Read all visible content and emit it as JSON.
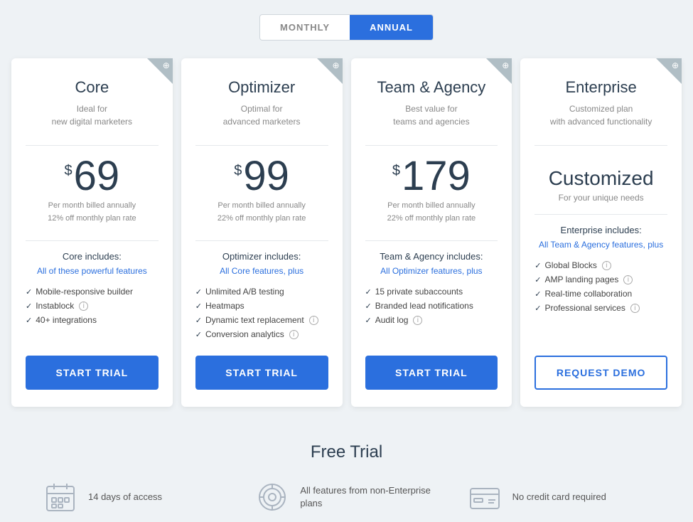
{
  "billing": {
    "monthly_label": "MONTHLY",
    "annual_label": "ANNUAL",
    "active": "annual"
  },
  "plans": [
    {
      "id": "core",
      "name": "Core",
      "tagline_line1": "Ideal for",
      "tagline_line2": "new digital marketers",
      "price_dollar": "$",
      "price": "69",
      "billing_note_line1": "Per month billed annually",
      "billing_note_line2": "12% off monthly plan rate",
      "includes_label": "Core includes:",
      "includes_link": "All of these powerful features",
      "features": [
        {
          "text": "Mobile-responsive builder",
          "info": false
        },
        {
          "text": "Instablock",
          "info": true
        },
        {
          "text": "40+ integrations",
          "info": false
        }
      ],
      "cta_label": "START TRIAL",
      "cta_type": "primary"
    },
    {
      "id": "optimizer",
      "name": "Optimizer",
      "tagline_line1": "Optimal for",
      "tagline_line2": "advanced marketers",
      "price_dollar": "$",
      "price": "99",
      "billing_note_line1": "Per month billed annually",
      "billing_note_line2": "22% off monthly plan rate",
      "includes_label": "Optimizer includes:",
      "includes_link": "All Core features, plus",
      "features": [
        {
          "text": "Unlimited A/B testing",
          "info": false
        },
        {
          "text": "Heatmaps",
          "info": false
        },
        {
          "text": "Dynamic text replacement",
          "info": true
        },
        {
          "text": "Conversion analytics",
          "info": true
        }
      ],
      "cta_label": "START TRIAL",
      "cta_type": "primary"
    },
    {
      "id": "team-agency",
      "name": "Team & Agency",
      "tagline_line1": "Best value for",
      "tagline_line2": "teams and agencies",
      "price_dollar": "$",
      "price": "179",
      "billing_note_line1": "Per month billed annually",
      "billing_note_line2": "22% off monthly plan rate",
      "includes_label": "Team & Agency includes:",
      "includes_link": "All Optimizer features, plus",
      "features": [
        {
          "text": "15 private subaccounts",
          "info": false
        },
        {
          "text": "Branded lead notifications",
          "info": false
        },
        {
          "text": "Audit log",
          "info": true
        }
      ],
      "cta_label": "START TRIAL",
      "cta_type": "primary"
    },
    {
      "id": "enterprise",
      "name": "Enterprise",
      "tagline_line1": "Customized plan",
      "tagline_line2": "with advanced functionality",
      "price_custom": "Customized",
      "price_custom_sub": "For your unique needs",
      "includes_label": "Enterprise includes:",
      "includes_link": "All Team & Agency features, plus",
      "features": [
        {
          "text": "Global Blocks",
          "info": true
        },
        {
          "text": "AMP landing pages",
          "info": true
        },
        {
          "text": "Real-time collaboration",
          "info": false
        },
        {
          "text": "Professional services",
          "info": true
        }
      ],
      "cta_label": "REQUEST DEMO",
      "cta_type": "outline"
    }
  ],
  "free_trial": {
    "title": "Free Trial",
    "items": [
      {
        "icon": "calendar",
        "text": "14 days of access"
      },
      {
        "icon": "target",
        "text": "All features from non-Enterprise plans"
      },
      {
        "icon": "card",
        "text": "No credit card required"
      }
    ]
  }
}
